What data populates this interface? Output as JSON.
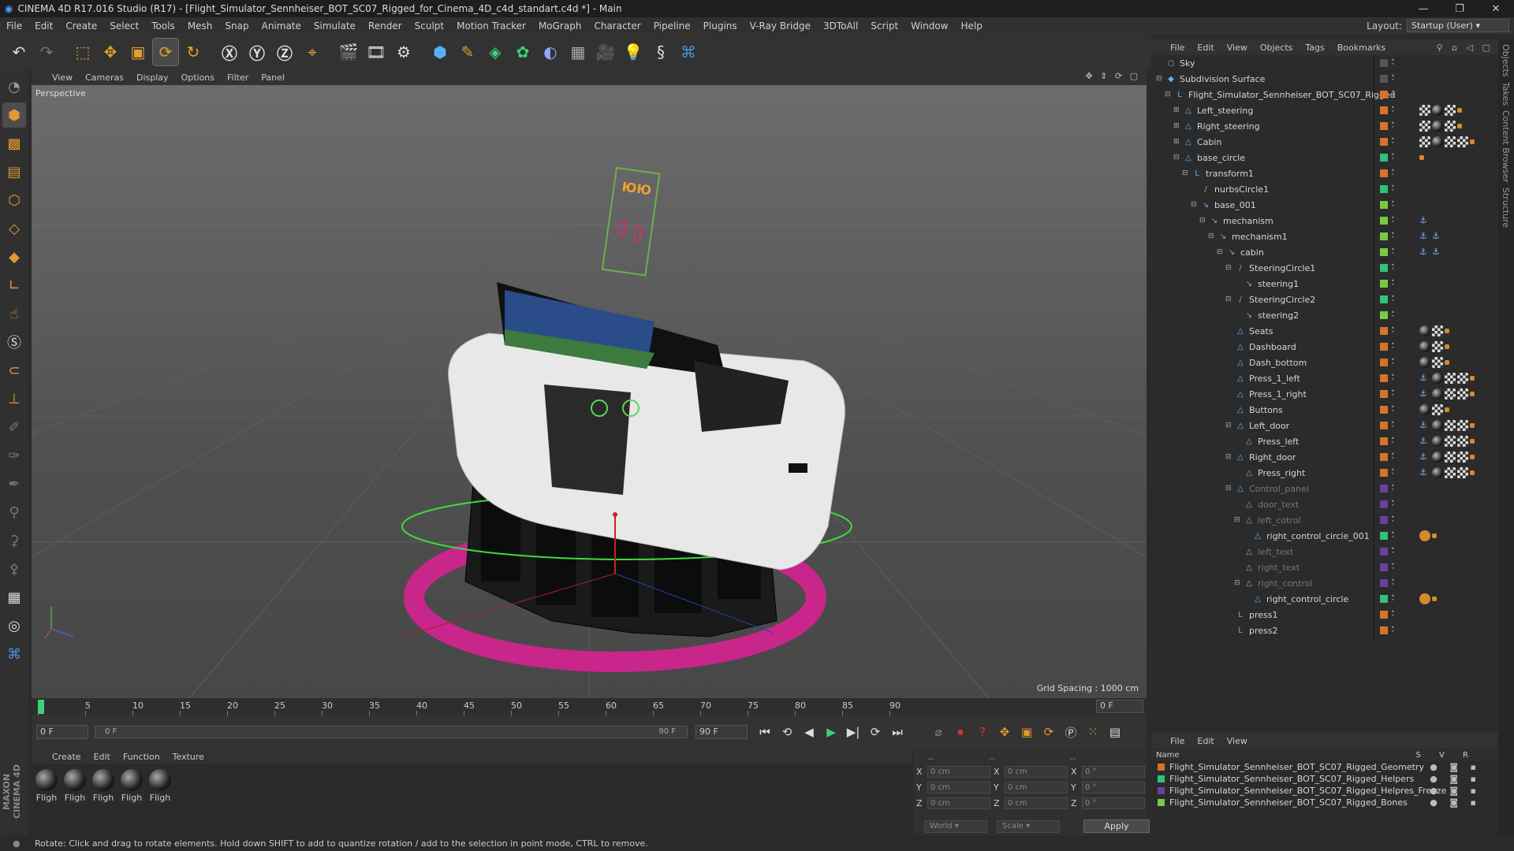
{
  "window": {
    "title": "CINEMA 4D R17.016 Studio (R17) - [Flight_Simulator_Sennheiser_BOT_SC07_Rigged_for_Cinema_4D_c4d_standart.c4d *] - Main"
  },
  "menubar": {
    "items": [
      "File",
      "Edit",
      "Create",
      "Select",
      "Tools",
      "Mesh",
      "Snap",
      "Animate",
      "Simulate",
      "Render",
      "Sculpt",
      "Motion Tracker",
      "MoGraph",
      "Character",
      "Pipeline",
      "Plugins",
      "V-Ray Bridge",
      "3DToAll",
      "Script",
      "Window",
      "Help"
    ],
    "layout_label": "Layout:",
    "layout_value": "Startup (User)"
  },
  "viewport": {
    "menu": [
      "View",
      "Cameras",
      "Display",
      "Options",
      "Filter",
      "Panel"
    ],
    "label": "Perspective",
    "grid_spacing": "Grid Spacing : 1000 cm"
  },
  "timeline": {
    "ticks": [
      "0",
      "5",
      "10",
      "15",
      "20",
      "25",
      "30",
      "35",
      "40",
      "45",
      "50",
      "55",
      "60",
      "65",
      "70",
      "75",
      "80",
      "85",
      "90"
    ],
    "current_frame": "0 F",
    "start_field": "0 F",
    "range_start": "0 F",
    "range_end": "90 F",
    "end_field": "90 F"
  },
  "material_manager": {
    "menu": [
      "Create",
      "Edit",
      "Function",
      "Texture"
    ],
    "materials": [
      "Fligh",
      "Fligh",
      "Fligh",
      "Fligh",
      "Fligh"
    ]
  },
  "coordinates": {
    "rows": [
      {
        "a": "X",
        "av": "0 cm",
        "b": "X",
        "bv": "0 cm",
        "c": "X",
        "cv": "0 °"
      },
      {
        "a": "Y",
        "av": "0 cm",
        "b": "Y",
        "bv": "0 cm",
        "c": "Y",
        "cv": "0 °"
      },
      {
        "a": "Z",
        "av": "0 cm",
        "b": "Z",
        "bv": "0 cm",
        "c": "Z",
        "cv": "0 °"
      }
    ],
    "header_a": "--",
    "header_b": "--",
    "header_c": "--",
    "world": "World",
    "scale": "Scale",
    "apply": "Apply"
  },
  "status": "Rotate: Click and drag to rotate elements. Hold down SHIFT to add to quantize rotation / add to the selection in point mode, CTRL to remove.",
  "object_manager": {
    "menu": [
      "File",
      "Edit",
      "View",
      "Objects",
      "Tags",
      "Bookmarks"
    ],
    "objects": [
      {
        "name": "Sky",
        "depth": 0,
        "exp": "",
        "icon": "○",
        "layer": "",
        "dim": false,
        "tags": []
      },
      {
        "name": "Subdivision Surface",
        "depth": 0,
        "exp": "⊟",
        "icon": "◆",
        "layer": "",
        "dim": false,
        "tags": []
      },
      {
        "name": "Flight_Simulator_Sennheiser_BOT_SC07_Rigged",
        "depth": 1,
        "exp": "⊟",
        "icon": "L",
        "layer": "#d8722a",
        "dim": false,
        "tags": []
      },
      {
        "name": "Left_steering",
        "depth": 2,
        "exp": "⊞",
        "icon": "△",
        "layer": "#d8722a",
        "dim": false,
        "tags": [
          "check",
          "ball",
          "check",
          "orange"
        ]
      },
      {
        "name": "Right_steering",
        "depth": 2,
        "exp": "⊞",
        "icon": "△",
        "layer": "#d8722a",
        "dim": false,
        "tags": [
          "check",
          "ball",
          "check",
          "orange"
        ]
      },
      {
        "name": "Cabin",
        "depth": 2,
        "exp": "⊞",
        "icon": "△",
        "layer": "#d8722a",
        "dim": false,
        "tags": [
          "check",
          "ball",
          "check",
          "check",
          "orange"
        ]
      },
      {
        "name": "base_circle",
        "depth": 2,
        "exp": "⊟",
        "icon": "△",
        "layer": "#2ec27e",
        "dim": false,
        "tags": [
          "orange"
        ]
      },
      {
        "name": "transform1",
        "depth": 3,
        "exp": "⊟",
        "icon": "L",
        "layer": "#d8722a",
        "dim": false,
        "tags": []
      },
      {
        "name": "nurbsCircle1",
        "depth": 4,
        "exp": "",
        "icon": "/",
        "layer": "#2ec27e",
        "dim": false,
        "tags": []
      },
      {
        "name": "base_001",
        "depth": 4,
        "exp": "⊟",
        "icon": "↘",
        "layer": "#7ac943",
        "dim": false,
        "tags": []
      },
      {
        "name": "mechanism",
        "depth": 5,
        "exp": "⊟",
        "icon": "↘",
        "layer": "#7ac943",
        "dim": false,
        "tags": [
          "ik"
        ]
      },
      {
        "name": "mechanism1",
        "depth": 6,
        "exp": "⊟",
        "icon": "↘",
        "layer": "#7ac943",
        "dim": false,
        "tags": [
          "ik",
          "ik"
        ]
      },
      {
        "name": "cabin",
        "depth": 7,
        "exp": "⊟",
        "icon": "↘",
        "layer": "#7ac943",
        "dim": false,
        "tags": [
          "ik",
          "ik"
        ]
      },
      {
        "name": "SteeringCircle1",
        "depth": 8,
        "exp": "⊟",
        "icon": "/",
        "layer": "#2ec27e",
        "dim": false,
        "tags": []
      },
      {
        "name": "steering1",
        "depth": 9,
        "exp": "",
        "icon": "↘",
        "layer": "#7ac943",
        "dim": false,
        "tags": []
      },
      {
        "name": "SteeringCircle2",
        "depth": 8,
        "exp": "⊟",
        "icon": "/",
        "layer": "#2ec27e",
        "dim": false,
        "tags": []
      },
      {
        "name": "steering2",
        "depth": 9,
        "exp": "",
        "icon": "↘",
        "layer": "#7ac943",
        "dim": false,
        "tags": []
      },
      {
        "name": "Seats",
        "depth": 8,
        "exp": "",
        "icon": "△",
        "layer": "#d8722a",
        "dim": false,
        "tags": [
          "ball",
          "check",
          "orange"
        ]
      },
      {
        "name": "Dashboard",
        "depth": 8,
        "exp": "",
        "icon": "△",
        "layer": "#d8722a",
        "dim": false,
        "tags": [
          "ball",
          "check",
          "orange"
        ]
      },
      {
        "name": "Dash_bottom",
        "depth": 8,
        "exp": "",
        "icon": "△",
        "layer": "#d8722a",
        "dim": false,
        "tags": [
          "ball",
          "check",
          "orange"
        ]
      },
      {
        "name": "Press_1_left",
        "depth": 8,
        "exp": "",
        "icon": "△",
        "layer": "#d8722a",
        "dim": false,
        "tags": [
          "ik",
          "ball",
          "check",
          "check",
          "orange"
        ]
      },
      {
        "name": "Press_1_right",
        "depth": 8,
        "exp": "",
        "icon": "△",
        "layer": "#d8722a",
        "dim": false,
        "tags": [
          "ik",
          "ball",
          "check",
          "check",
          "orange"
        ]
      },
      {
        "name": "Buttons",
        "depth": 8,
        "exp": "",
        "icon": "△",
        "layer": "#d8722a",
        "dim": false,
        "tags": [
          "ball",
          "check",
          "orange"
        ]
      },
      {
        "name": "Left_door",
        "depth": 8,
        "exp": "⊟",
        "icon": "△",
        "layer": "#d8722a",
        "dim": false,
        "tags": [
          "ik",
          "ball",
          "check",
          "check",
          "orange"
        ]
      },
      {
        "name": "Press_left",
        "depth": 9,
        "exp": "",
        "icon": "△",
        "layer": "#d8722a",
        "dim": false,
        "tags": [
          "ik",
          "ball",
          "check",
          "check",
          "orange"
        ]
      },
      {
        "name": "Right_door",
        "depth": 8,
        "exp": "⊟",
        "icon": "△",
        "layer": "#d8722a",
        "dim": false,
        "tags": [
          "ik",
          "ball",
          "check",
          "check",
          "orange"
        ]
      },
      {
        "name": "Press_right",
        "depth": 9,
        "exp": "",
        "icon": "△",
        "layer": "#d8722a",
        "dim": false,
        "tags": [
          "ik",
          "ball",
          "check",
          "check",
          "orange"
        ]
      },
      {
        "name": "Control_panel",
        "depth": 8,
        "exp": "⊟",
        "icon": "△",
        "layer": "#6b3fa0",
        "dim": true,
        "tags": []
      },
      {
        "name": "door_text",
        "depth": 9,
        "exp": "",
        "icon": "△",
        "layer": "#6b3fa0",
        "dim": true,
        "tags": []
      },
      {
        "name": "left_cotrol",
        "depth": 9,
        "exp": "⊟",
        "icon": "△",
        "layer": "#6b3fa0",
        "dim": true,
        "tags": []
      },
      {
        "name": "right_control_circle_001",
        "depth": 10,
        "exp": "",
        "icon": "△",
        "layer": "#2ec27e",
        "dim": false,
        "tags": [
          "stop",
          "orange"
        ]
      },
      {
        "name": "left_text",
        "depth": 9,
        "exp": "",
        "icon": "△",
        "layer": "#6b3fa0",
        "dim": true,
        "tags": []
      },
      {
        "name": "right_text",
        "depth": 9,
        "exp": "",
        "icon": "△",
        "layer": "#6b3fa0",
        "dim": true,
        "tags": []
      },
      {
        "name": "right_control",
        "depth": 9,
        "exp": "⊟",
        "icon": "△",
        "layer": "#6b3fa0",
        "dim": true,
        "tags": []
      },
      {
        "name": "right_control_circle",
        "depth": 10,
        "exp": "",
        "icon": "△",
        "layer": "#2ec27e",
        "dim": false,
        "tags": [
          "stop",
          "orange"
        ]
      },
      {
        "name": "press1",
        "depth": 8,
        "exp": "",
        "icon": "L",
        "layer": "#d8722a",
        "dim": false,
        "tags": []
      },
      {
        "name": "press2",
        "depth": 8,
        "exp": "",
        "icon": "L",
        "layer": "#d8722a",
        "dim": false,
        "tags": []
      }
    ]
  },
  "side_tabs": [
    "Objects",
    "Takes",
    "Content Browser",
    "Structure"
  ],
  "layer_manager": {
    "menu": [
      "File",
      "Edit",
      "View"
    ],
    "header_name": "Name",
    "header_cols": "S V R",
    "layers": [
      {
        "name": "Flight_Simulator_Sennheiser_BOT_SC07_Rigged_Geometry",
        "color": "#d8722a"
      },
      {
        "name": "Flight_Simulator_Sennheiser_BOT_SC07_Rigged_Helpers",
        "color": "#2ec27e"
      },
      {
        "name": "Flight_Simulator_Sennheiser_BOT_SC07_Rigged_Helpres_Freeze",
        "color": "#6b3fa0"
      },
      {
        "name": "Flight_Simulator_Sennheiser_BOT_SC07_Rigged_Bones",
        "color": "#7ac943"
      }
    ]
  },
  "brand": "MAXON CINEMA 4D"
}
